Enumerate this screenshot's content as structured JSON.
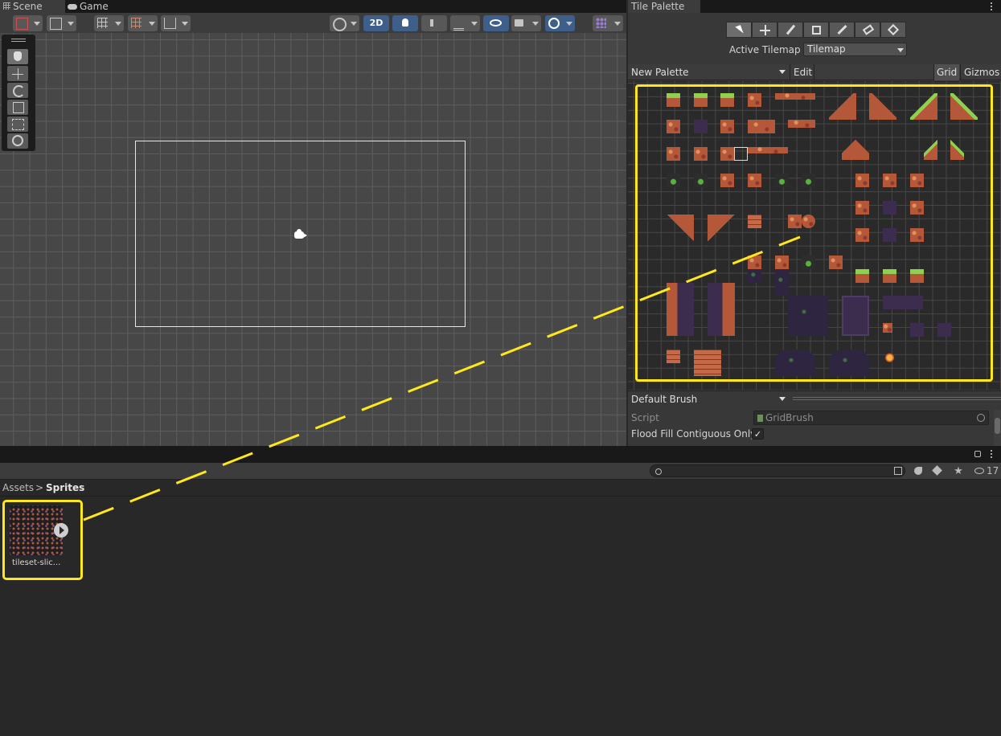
{
  "tabs": {
    "scene": "Scene",
    "game": "Game",
    "tile_palette": "Tile Palette"
  },
  "scene_toolbar": {
    "mode_2d": "2D"
  },
  "tile_palette": {
    "active_tilemap_label": "Active Tilemap",
    "active_tilemap_value": "Tilemap",
    "palette_name": "New Palette",
    "edit_label": "Edit",
    "grid_label": "Grid",
    "gizmos_label": "Gizmos",
    "brush_name": "Default Brush",
    "script_label": "Script",
    "script_value": "GridBrush",
    "flood_fill_label": "Flood Fill Contiguous Only",
    "flood_fill_checked": true,
    "checkmark": "✓"
  },
  "project": {
    "breadcrumb_root": "Assets",
    "breadcrumb_sep": ">",
    "breadcrumb_current": "Sprites",
    "search_placeholder": "",
    "hidden_count": "17",
    "asset_name": "tileset-slic..."
  },
  "colors": {
    "highlight": "#ffe81a",
    "toolbar_active_blue": "#3e5f8a"
  }
}
